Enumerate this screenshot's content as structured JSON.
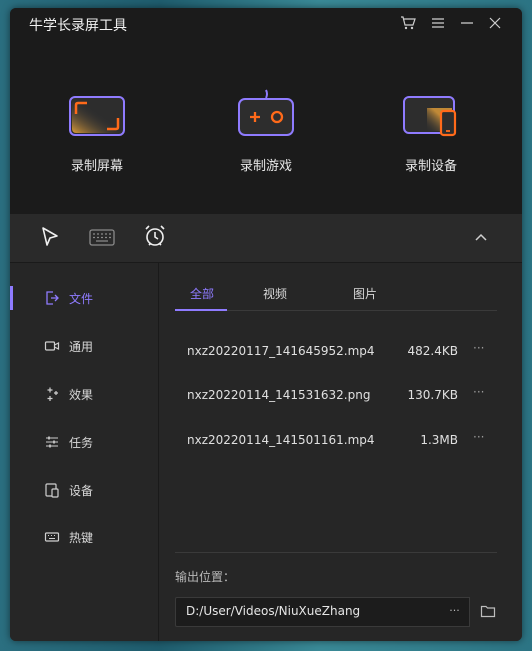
{
  "app": {
    "title": "牛学长录屏工具"
  },
  "features": [
    {
      "label": "录制屏幕",
      "icon": "screen-record-icon"
    },
    {
      "label": "录制游戏",
      "icon": "gamepad-icon"
    },
    {
      "label": "录制设备",
      "icon": "device-record-icon"
    }
  ],
  "toolbar": {
    "icons": [
      "cursor-icon",
      "keyboard-icon",
      "alarm-clock-icon",
      "chevron-up-icon"
    ]
  },
  "sidebar": {
    "items": [
      {
        "label": "文件",
        "icon": "file-icon",
        "active": true
      },
      {
        "label": "通用",
        "icon": "camera-icon"
      },
      {
        "label": "效果",
        "icon": "sparkle-icon"
      },
      {
        "label": "任务",
        "icon": "sliders-icon"
      },
      {
        "label": "设备",
        "icon": "device-icon"
      },
      {
        "label": "热键",
        "icon": "keyboard-icon"
      }
    ]
  },
  "tabs": [
    {
      "label": "全部",
      "active": true
    },
    {
      "label": "视频"
    },
    {
      "label": "图片"
    }
  ],
  "files": [
    {
      "name": "nxz20220117_141645952.mp4",
      "size": "482.4KB"
    },
    {
      "name": "nxz20220114_141531632.png",
      "size": "130.7KB"
    },
    {
      "name": "nxz20220114_141501161.mp4",
      "size": "1.3MB"
    }
  ],
  "output": {
    "label": "输出位置：",
    "path": "D:/User/Videos/NiuXueZhang",
    "more": "···"
  },
  "more_glyph": "···",
  "colors": {
    "accent": "#8f7bff",
    "orange": "#ff6a1a",
    "background": "#262626",
    "header": "#1b1b1b"
  }
}
